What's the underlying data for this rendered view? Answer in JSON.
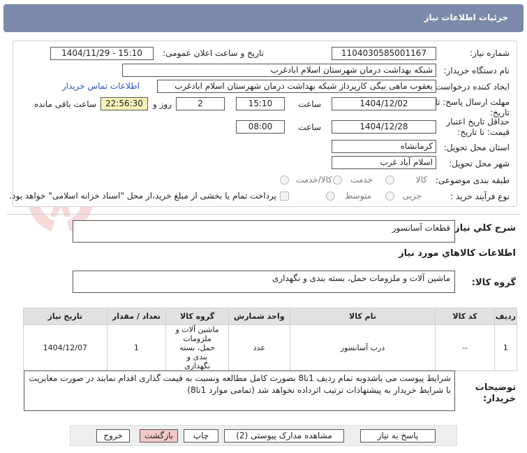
{
  "header": {
    "title": "جزئیات اطلاعات نیاز"
  },
  "fields": {
    "need_number_label": "شماره نیاز:",
    "need_number": "1104030585001167",
    "announce_label": "تاریخ و ساعت اعلان عمومی:",
    "announce_value": "1404/11/29 - 15:10",
    "buyer_org_label": "نام دستگاه خریدار:",
    "buyer_org": "شبکه بهداشت درمان شهرستان اسلام ابادغرب",
    "creator_label": "ایجاد کننده درخواست:",
    "creator": "یعقوب ماهی بیگی کارپرداز شبکه بهداشت درمان شهرستان اسلام ابادغرب",
    "contact_link": "اطلاعات تماس خریدار",
    "deadline_label_1": "مهلت ارسال پاسخ: تا",
    "deadline_label_2": "تاریخ:",
    "deadline_date": "1404/12/02",
    "time_label": "ساعت",
    "deadline_time": "15:10",
    "days_value": "2",
    "days_label": "روز و",
    "remaining_time": "22:56:30",
    "remaining_label": "ساعت باقی مانده",
    "validity_label_1": "حداقل تاریخ اعتبار",
    "validity_label_2": "قیمت: تا تاریخ:",
    "validity_date": "1404/12/28",
    "validity_time": "08:00",
    "province_label": "استان محل تحویل:",
    "province": "کرمانشاه",
    "city_label": "شهر محل تحویل:",
    "city": "اسلام آباد غرب",
    "category_label": "طبقه بندی موضوعی:",
    "category_options": [
      "کالا",
      "خدمت",
      "کالا/خدمت"
    ],
    "purchase_label": "نوع فرآیند خرید :",
    "purchase_options": [
      "جزیی",
      "متوسط"
    ],
    "payment_note": "پرداخت تمام یا بخشی از مبلغ خرید،از محل \"اسناد خزانه اسلامی\" خواهد بود."
  },
  "summary": {
    "label": "شرح کلي نیاز:",
    "value": "قطعات آسانسور"
  },
  "goods_info": {
    "title": "اطلاعات کالاهاي مورد نياز",
    "group_label": "گروه کالا:",
    "group_value": "ماشین آلات و ملزومات حمل، بسته بندی و نگهداری"
  },
  "table": {
    "headers": [
      "ردیف",
      "کد کالا",
      "نام کالا",
      "واحد شمارش",
      "گروه کالا",
      "تعداد / مقدار",
      "تاریخ نیاز"
    ],
    "rows": [
      [
        "1",
        "--",
        "درب آسانسور",
        "عدد",
        "ماشین آلات و ملزومات حمل، بسته بندی و نگهداری",
        "1",
        "1404/12/07"
      ]
    ]
  },
  "buyer_notes": {
    "label_1": "توضیحات",
    "label_2": "خریدار:",
    "text": "شرایط پیوست می باشدوبه تمام ردیف 1تا8 بصورت کامل مطالعه ونسبت به قیمت گذاری اقدام نمایند در صورت مغایریت با شرایط خریدار به پیشنهادات ترتیب اثرداده نخواهد شد (تمامی موارد 1تا8)"
  },
  "buttons": {
    "reply": "پاسخ به نیاز",
    "docs": "مشاهده مدارک پیوستی (2)",
    "print": "چاپ",
    "back": "بازگشت",
    "exit": "خروج"
  },
  "colors": {
    "header_bg": "#7b8aaa",
    "link": "#2c53c9",
    "highlight": "#f7f3b8",
    "back_button": "#f3c9c9"
  }
}
